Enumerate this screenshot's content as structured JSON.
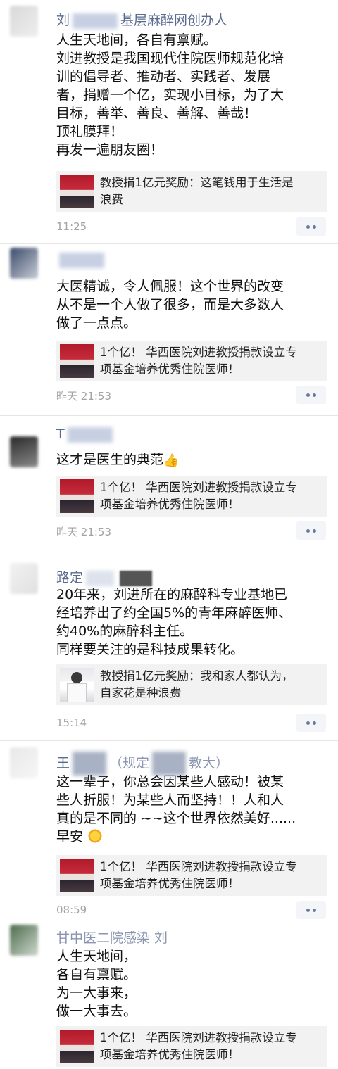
{
  "posts": [
    {
      "name_prefix": "刘",
      "name_suffix": "基层麻醉网创办人",
      "lines": [
        "人生天地间，各自有禀赋。",
        "刘进教授是我国现代住院医师规范化培",
        "训的倡导者、推动者、实践者、发展",
        "者，捐赠一个亿，实现小目标，为了大",
        "目标，善举、善良、善解、善哉！",
        "顶礼膜拜！",
        "再发一遍朋友圈！"
      ],
      "card": {
        "lines": [
          "教授捐1亿元奖励：这笔钱用于生活是",
          "浪费"
        ]
      },
      "time": "11:25"
    },
    {
      "lines": [
        "大医精诚，令人佩服！这个世界的改变",
        "从不是一个人做了很多，而是大多数人",
        "做了一点点。"
      ],
      "card": {
        "lines": [
          "1个亿！ 华西医院刘进教授捐款设立专",
          "项基金培养优秀住院医师！"
        ]
      },
      "time": "昨天 21:53"
    },
    {
      "name_prefix": "T",
      "lines": [
        "这才是医生的典范"
      ],
      "card": {
        "lines": [
          "1个亿！ 华西医院刘进教授捐款设立专",
          "项基金培养优秀住院医师！"
        ]
      },
      "time": "昨天 21:53"
    },
    {
      "name_prefix": "路定",
      "lines": [
        "20年来，刘进所在的麻醉科专业基地已",
        "经培养出了约全国5%的青年麻醉医师、",
        "约40%的麻醉科主任。",
        "同样要关注的是科技成果转化。"
      ],
      "card": {
        "lines": [
          "教授捐1亿元奖励：我和家人都认为，",
          "自家花是种浪费"
        ]
      },
      "time": "15:14"
    },
    {
      "name_prefix": "王",
      "name_mid": "（规定",
      "name_suffix": "教大）",
      "lines": [
        "这一辈子，你总会因某些人感动！被某",
        "些人折服！为某些人而坚持！！人和人",
        "真的是不同的 ~~这个世界依然美好......",
        "早安"
      ],
      "card": {
        "lines": [
          "1个亿！ 华西医院刘进教授捐款设立专",
          "项基金培养优秀住院医师！"
        ]
      },
      "time": "08:59"
    },
    {
      "name_prefix": "甘中医二院感染 刘",
      "lines": [
        "人生天地间，",
        "各自有禀赋。",
        "为一大事来，",
        "做一大事去。"
      ],
      "card": {
        "lines": [
          "1个亿！ 华西医院刘进教授捐款设立专",
          "项基金培养优秀住院医师！"
        ]
      }
    }
  ]
}
